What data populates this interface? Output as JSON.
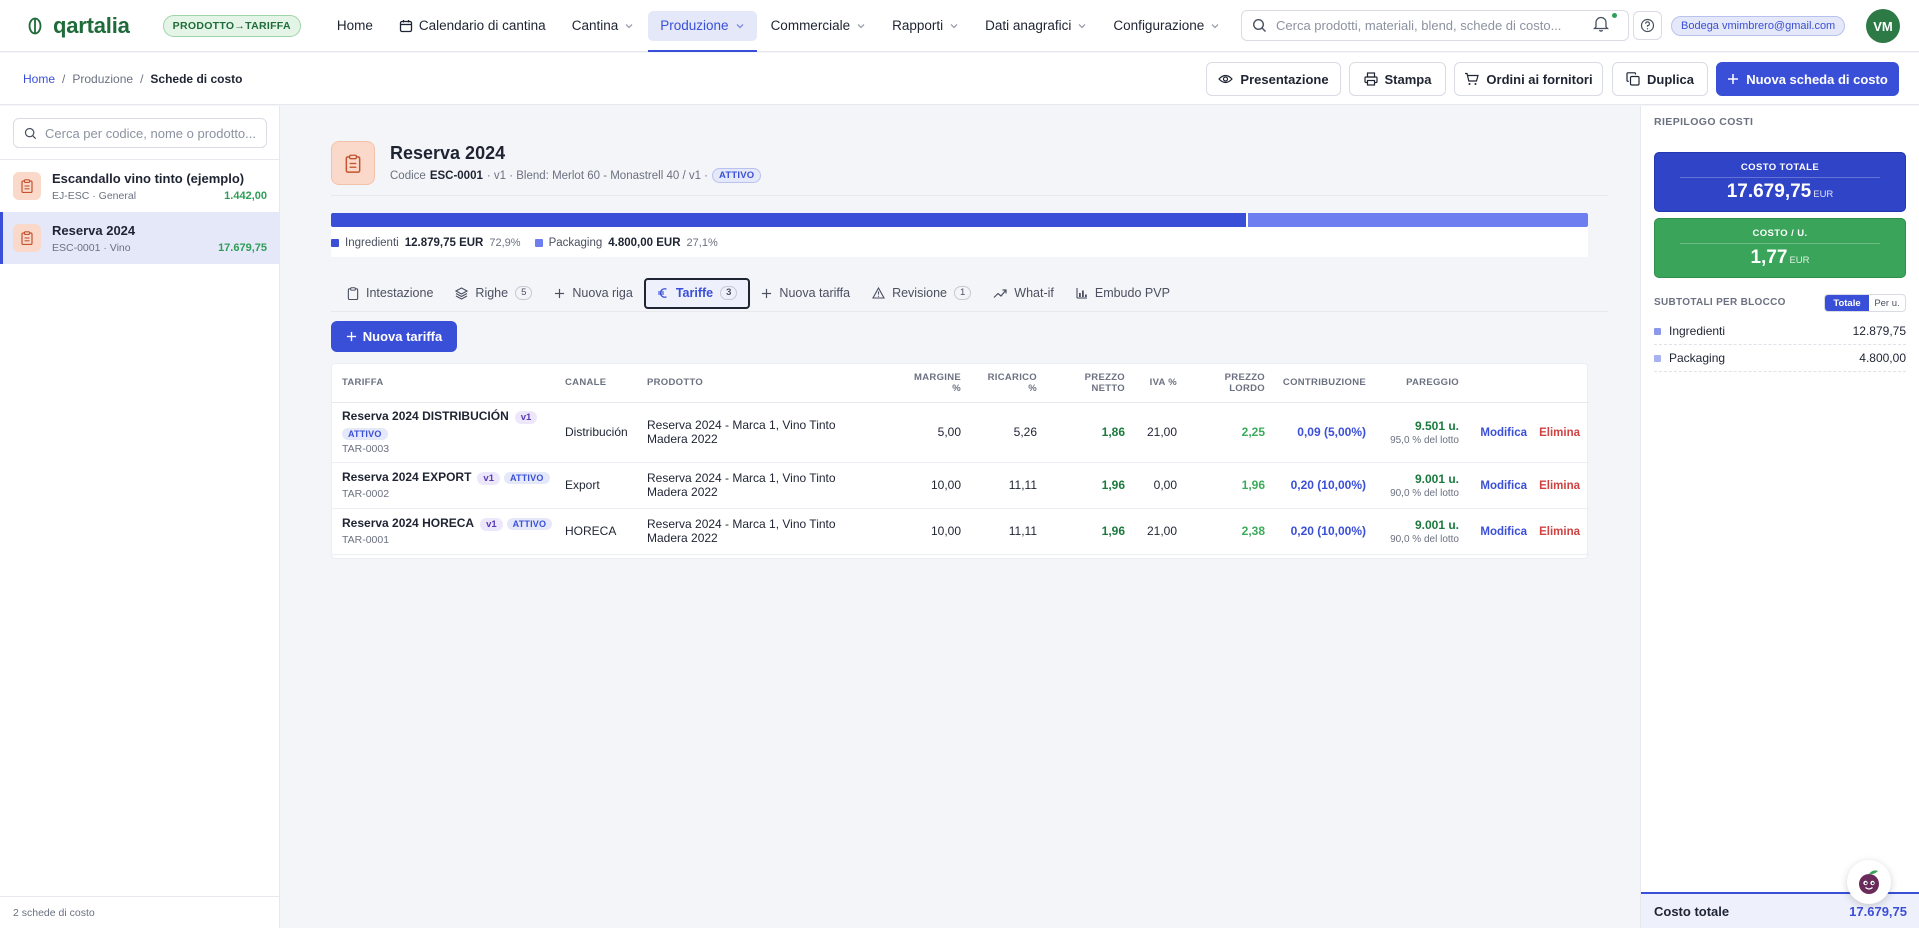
{
  "app": {
    "logo_text": "qartalia",
    "context_badge": "PRODOTTO→TARIFFA",
    "user_email": "Bodega vmimbrero@gmail.com",
    "user_initials": "VM",
    "colors": {
      "accent": "#3a4fd8",
      "brand": "#1f6b3a",
      "success": "#2f9e57",
      "danger": "#d04242"
    }
  },
  "nav": {
    "items": [
      {
        "label": "Home",
        "dropdown": false
      },
      {
        "label": "Calendario di cantina",
        "dropdown": false,
        "icon": "calendar-icon"
      },
      {
        "label": "Cantina",
        "dropdown": true
      },
      {
        "label": "Produzione",
        "dropdown": true,
        "active": true
      },
      {
        "label": "Commerciale",
        "dropdown": true
      },
      {
        "label": "Rapporti",
        "dropdown": true
      },
      {
        "label": "Dati anagrafici",
        "dropdown": true
      },
      {
        "label": "Configurazione",
        "dropdown": true
      }
    ],
    "search_placeholder": "Cerca prodotti, materiali, blend, schede di costo..."
  },
  "breadcrumb": {
    "home": "Home",
    "section": "Produzione",
    "current": "Schede di costo",
    "sep": "/"
  },
  "toolbar": {
    "presentazione": "Presentazione",
    "stampa": "Stampa",
    "ordini": "Ordini ai fornitori",
    "duplica": "Duplica",
    "nuova_scheda": "Nuova scheda di costo"
  },
  "sidebar": {
    "search_placeholder": "Cerca per codice, nome o prodotto...",
    "items": [
      {
        "name": "Escandallo vino tinto (ejemplo)",
        "sub": "EJ-ESC · General",
        "value": "1.442,00"
      },
      {
        "name": "Reserva 2024",
        "sub": "ESC-0001 · Vino",
        "value": "17.679,75"
      }
    ],
    "footer": "2 schede di costo"
  },
  "header": {
    "title": "Reserva 2024",
    "code_label": "Codice",
    "code": "ESC-0001",
    "meta": "· v1 · Blend: Merlot 60 - Monastrell 40 / v1 ·",
    "status": "ATTIVO"
  },
  "cost_breakdown": {
    "ingredients_label": "Ingredienti",
    "ingredients_value": "12.879,75 EUR",
    "ingredients_pct": "72,9%",
    "ingredients_share": 0.729,
    "packaging_label": "Packaging",
    "packaging_value": "4.800,00 EUR",
    "packaging_pct": "27,1%",
    "packaging_share": 0.271
  },
  "tabs": [
    {
      "label": "Intestazione",
      "icon": "clipboard-icon",
      "count": ""
    },
    {
      "label": "Righe",
      "icon": "layers-icon",
      "count": "5"
    },
    {
      "label": "Nuova riga",
      "icon": "plus-icon",
      "count": ""
    },
    {
      "label": "Tariffe",
      "icon": "euro-icon",
      "count": "3",
      "active": true
    },
    {
      "label": "Nuova tariffa",
      "icon": "plus-icon",
      "count": ""
    },
    {
      "label": "Revisione",
      "icon": "warning-icon",
      "count": "1"
    },
    {
      "label": "What-if",
      "icon": "trend-icon",
      "count": ""
    },
    {
      "label": "Embudo PVP",
      "icon": "bar-chart-icon",
      "count": ""
    }
  ],
  "new_tariffa_button": "Nuova tariffa",
  "table": {
    "columns": {
      "tariffa": "TARIFFA",
      "canale": "CANALE",
      "prodotto": "PRODOTTO",
      "margine": "MARGINE %",
      "ricarico": "RICARICO %",
      "prezzo_netto": "PREZZO NETTO",
      "iva": "IVA %",
      "prezzo_lordo": "PREZZO LORDO",
      "contribuzione": "CONTRIBUZIONE",
      "pareggio": "PAREGGIO"
    },
    "rows": [
      {
        "name": "Reserva 2024 DISTRIBUCIÓN",
        "version": "v1",
        "status": "ATTIVO",
        "code": "TAR-0003",
        "channel": "Distribución",
        "product": "Reserva 2024 - Marca 1, Vino Tinto Madera 2022",
        "margin": "5,00",
        "markup": "5,26",
        "net": "1,86",
        "vat": "21,00",
        "gross": "2,25",
        "contribution": "0,09 (5,00%)",
        "payback": "9.501 u.",
        "payback_sub": "95,0 % del lotto",
        "edit": "Modifica",
        "delete": "Elimina"
      },
      {
        "name": "Reserva 2024 EXPORT",
        "version": "v1",
        "status": "ATTIVO",
        "code": "TAR-0002",
        "channel": "Export",
        "product": "Reserva 2024 - Marca 1, Vino Tinto Madera 2022",
        "margin": "10,00",
        "markup": "11,11",
        "net": "1,96",
        "vat": "0,00",
        "gross": "1,96",
        "contribution": "0,20 (10,00%)",
        "payback": "9.001 u.",
        "payback_sub": "90,0 % del lotto",
        "edit": "Modifica",
        "delete": "Elimina"
      },
      {
        "name": "Reserva 2024 HORECA",
        "version": "v1",
        "status": "ATTIVO",
        "code": "TAR-0001",
        "channel": "HORECA",
        "product": "Reserva 2024 - Marca 1, Vino Tinto Madera 2022",
        "margin": "10,00",
        "markup": "11,11",
        "net": "1,96",
        "vat": "21,00",
        "gross": "2,38",
        "contribution": "0,20 (10,00%)",
        "payback": "9.001 u.",
        "payback_sub": "90,0 % del lotto",
        "edit": "Modifica",
        "delete": "Elimina"
      }
    ]
  },
  "summary": {
    "title": "RIEPILOGO COSTI",
    "total_label": "COSTO TOTALE",
    "total_value": "17.679,75",
    "total_unit": "EUR",
    "unit_label": "COSTO / U.",
    "unit_value": "1,77",
    "unit_unit": "EUR",
    "subtotals_label": "SUBTOTALI PER BLOCCO",
    "toggle_on": "Totale",
    "toggle_off": "Per u.",
    "blocks": [
      {
        "label": "Ingredienti",
        "value": "12.879,75",
        "color": "#8b98ec"
      },
      {
        "label": "Packaging",
        "value": "4.800,00",
        "color": "#a7b2f0"
      }
    ],
    "footer_label": "Costo totale",
    "footer_value": "17.679,75"
  }
}
